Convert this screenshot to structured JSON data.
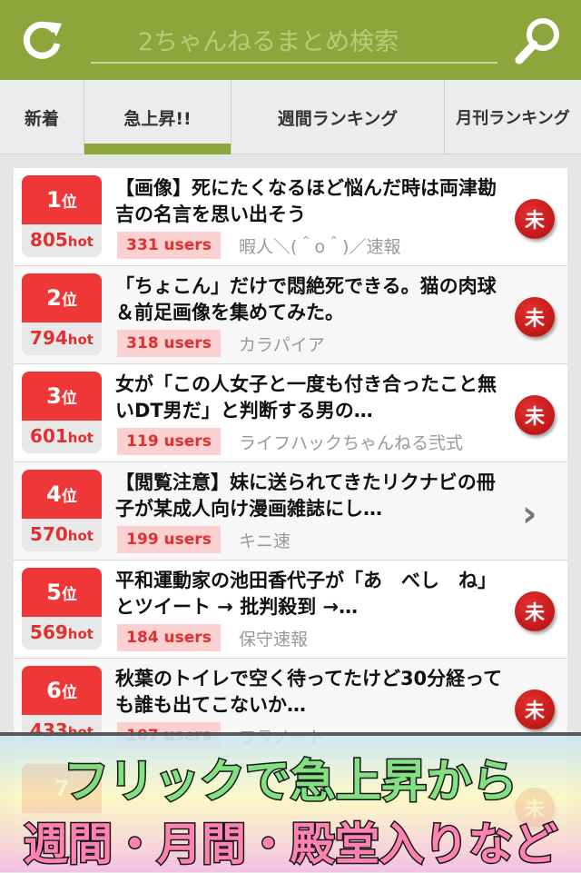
{
  "header": {
    "search_placeholder": "2ちゃんねるまとめ検索",
    "refresh_icon": "refresh-icon",
    "search_icon": "magnifier-icon",
    "color": "#8ea53b"
  },
  "tabs": [
    {
      "label": "新着"
    },
    {
      "label": "急上昇!!",
      "active": true
    },
    {
      "label": "週間ランキング"
    },
    {
      "label": "月刊ランキング"
    }
  ],
  "items": [
    {
      "rank": "1",
      "rank_suffix": "位",
      "hot": "805",
      "hot_suffix": "hot",
      "title": "【画像】死にたくなるほど悩んだ時は両津勘吉の名言を思い出そう",
      "users": "331 users",
      "site": "暇人＼(＾o＾)／速報",
      "badge": "未"
    },
    {
      "rank": "2",
      "rank_suffix": "位",
      "hot": "794",
      "hot_suffix": "hot",
      "title": "「ちょこん」だけで悶絶死できる。猫の肉球＆前足画像を集めてみた。",
      "users": "318 users",
      "site": "カラパイア",
      "badge": "未"
    },
    {
      "rank": "3",
      "rank_suffix": "位",
      "hot": "601",
      "hot_suffix": "hot",
      "title": "女が「この人女子と一度も付き合ったこと無いDT男だ」と判断する男の…",
      "users": "119 users",
      "site": "ライフハックちゃんねる弐式",
      "badge": "未"
    },
    {
      "rank": "4",
      "rank_suffix": "位",
      "hot": "570",
      "hot_suffix": "hot",
      "title": "【閲覧注意】妹に送られてきたリクナビの冊子が某成人向け漫画雑誌にし…",
      "users": "199 users",
      "site": "キニ速",
      "badge": ""
    },
    {
      "rank": "5",
      "rank_suffix": "位",
      "hot": "569",
      "hot_suffix": "hot",
      "title": "平和運動家の池田香代子が「あ　べし　ね」とツイート → 批判殺到 →…",
      "users": "184 users",
      "site": "保守速報",
      "badge": "未"
    },
    {
      "rank": "6",
      "rank_suffix": "位",
      "hot": "433",
      "hot_suffix": "hot",
      "title": "秋葉のトイレで空く待ってたけど30分経っても誰も出てこないか…",
      "users": "107 users",
      "site": "ワラノート",
      "badge": "未"
    },
    {
      "rank": "7",
      "rank_suffix": "",
      "hot": "",
      "hot_suffix": "",
      "title": "",
      "users": "",
      "site": "",
      "badge": "未"
    }
  ],
  "banner": {
    "line1": "フリックで急上昇から",
    "line2": "週間・月間・殿堂入りなど"
  }
}
